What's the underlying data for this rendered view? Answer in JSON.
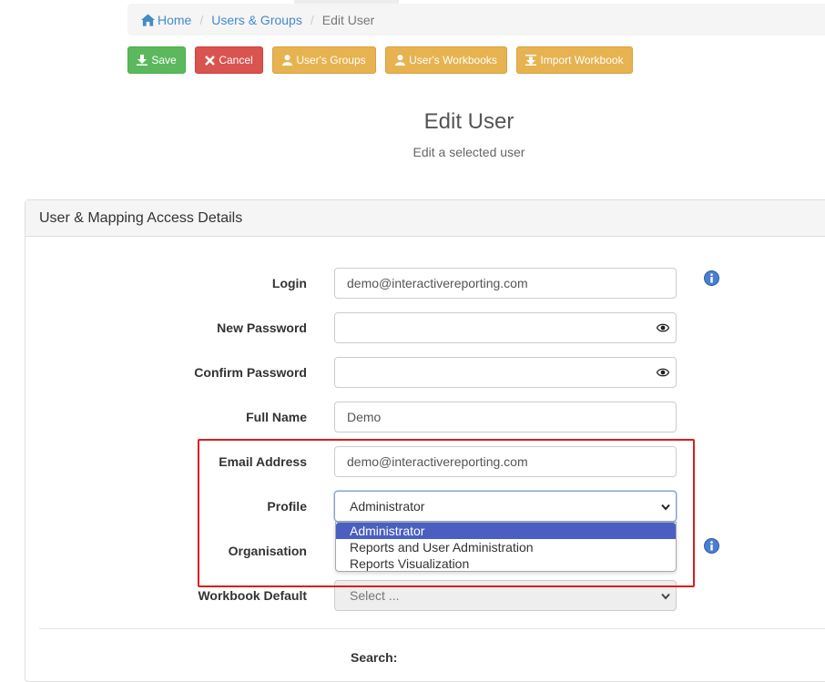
{
  "breadcrumb": {
    "home": "Home",
    "users_groups": "Users & Groups",
    "current": "Edit User"
  },
  "toolbar": {
    "save": "Save",
    "cancel": "Cancel",
    "users_groups": "User's Groups",
    "users_workbooks": "User's Workbooks",
    "import_workbook": "Import Workbook"
  },
  "header": {
    "title": "Edit User",
    "subtitle": "Edit a selected user"
  },
  "panel": {
    "heading": "User & Mapping Access Details"
  },
  "form": {
    "login_label": "Login",
    "login_value": "demo@interactivereporting.com",
    "new_password_label": "New Password",
    "confirm_password_label": "Confirm Password",
    "full_name_label": "Full Name",
    "full_name_value": "Demo",
    "email_label": "Email Address",
    "email_value": "demo@interactivereporting.com",
    "profile_label": "Profile",
    "profile_value": "Administrator",
    "organisation_label": "Organisation",
    "workbook_default_label": "Workbook Default",
    "workbook_default_value": "Select ...",
    "search_label": "Search:"
  },
  "profile_options": [
    "Administrator",
    "Reports and User Administration",
    "Reports Visualization"
  ],
  "colors": {
    "success": "#5cb85c",
    "danger": "#d9534f",
    "warning": "#e6b350",
    "link": "#428bca",
    "highlight": "#dd1c1c",
    "selected_option": "#4a5fc1"
  },
  "icons": {
    "home": "home-icon",
    "save": "download-icon",
    "cancel": "close-icon",
    "user": "user-icon",
    "import": "import-icon",
    "info": "info-icon",
    "eye": "eye-icon",
    "chevron": "chevron-down-icon"
  }
}
